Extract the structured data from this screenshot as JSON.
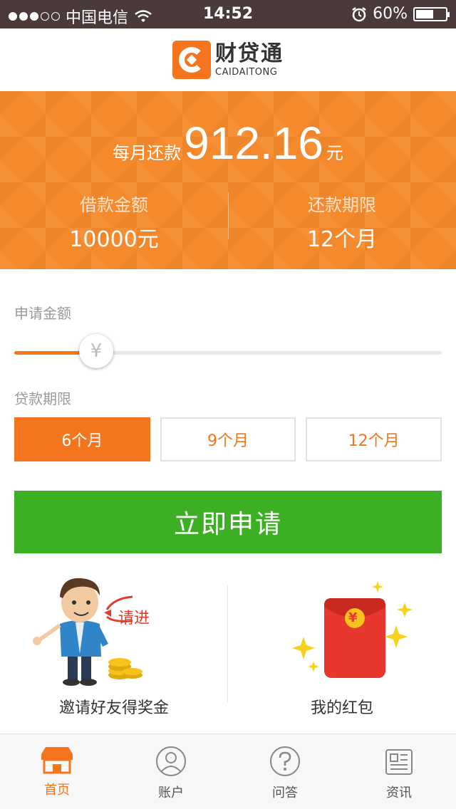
{
  "status_bar": {
    "carrier": "中国电信",
    "time": "14:52",
    "battery": "60%",
    "battery_level": 0.6,
    "signal_bars_filled": 3,
    "signal_bars_total": 5
  },
  "header": {
    "logo_cn": "财贷通",
    "logo_en": "CAIDAITONG"
  },
  "summary": {
    "monthly_label": "每月还款",
    "monthly_value": "912.16",
    "monthly_unit": "元",
    "loan_amount_label": "借款金额",
    "loan_amount_value": "10000元",
    "term_label": "还款期限",
    "term_value": "12个月"
  },
  "form": {
    "amount_label": "申请金额",
    "slider_symbol": "¥",
    "slider_level": 0.18,
    "term_label": "贷款期限",
    "terms": [
      {
        "label": "6个月",
        "active": true
      },
      {
        "label": "9个月",
        "active": false
      },
      {
        "label": "12个月",
        "active": false
      }
    ],
    "apply_button": "立即申请"
  },
  "promos": {
    "invite_caption": "邀请好友得奖金",
    "invite_bubble": "请进",
    "redpacket_caption": "我的红包",
    "redpacket_symbol": "¥"
  },
  "tabbar": [
    {
      "label": "首页",
      "icon": "home-store-icon",
      "active": true
    },
    {
      "label": "账户",
      "icon": "user-icon",
      "active": false
    },
    {
      "label": "问答",
      "icon": "question-icon",
      "active": false
    },
    {
      "label": "资讯",
      "icon": "news-icon",
      "active": false
    }
  ],
  "colors": {
    "accent": "#f5751f",
    "banner": "#f58a2c",
    "apply_green": "#3daf24",
    "redpacket": "#e8372c",
    "coin": "#f7c21a"
  }
}
